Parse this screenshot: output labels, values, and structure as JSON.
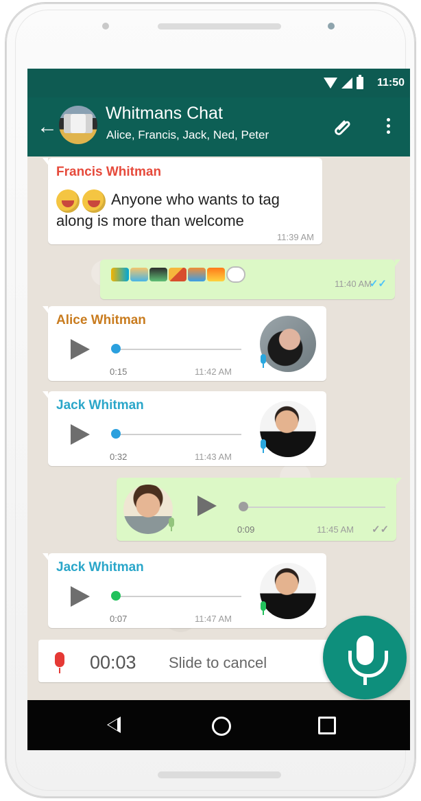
{
  "status_bar": {
    "time": "11:50"
  },
  "chat_header": {
    "title": "Whitmans Chat",
    "participants": "Alice, Francis, Jack, Ned, Peter"
  },
  "messages": [
    {
      "sender": "Francis Whitman",
      "text": "Anyone who wants to tag along is more than welcome",
      "time": "11:39 AM"
    },
    {
      "time": "11:40 AM"
    },
    {
      "sender": "Alice Whitman",
      "duration": "0:15",
      "time": "11:42 AM"
    },
    {
      "sender": "Jack Whitman",
      "duration": "0:32",
      "time": "11:43 AM"
    },
    {
      "duration": "0:09",
      "time": "11:45 AM"
    },
    {
      "sender": "Jack Whitman",
      "duration": "0:07",
      "time": "11:47 AM"
    }
  ],
  "recording": {
    "timer": "00:03",
    "hint": "Slide to cancel"
  },
  "colors": {
    "header": "#0d5f55",
    "outgoing_bubble": "#dcf8c6",
    "fab": "#0e8f7c",
    "francis_name": "#e64a3b",
    "alice_name": "#c97c1f",
    "jack_name": "#2aa6c9"
  }
}
